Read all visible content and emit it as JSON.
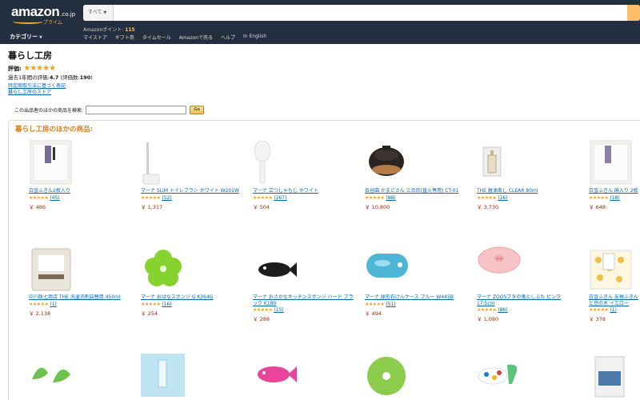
{
  "header": {
    "logo_word": "amazon",
    "logo_domain": ".co.jp",
    "logo_prime": "プライム",
    "search_category": "すべて",
    "points_label": "Amazonポイント: ",
    "points_value": "115",
    "nav_links": [
      "マイストア",
      "ギフト券",
      "タイムセール",
      "Amazonで売る",
      "ヘルプ",
      "In English"
    ],
    "category_label": "カテゴリー"
  },
  "seller": {
    "name": "暮らし工房",
    "rating_label": "評価:",
    "rating_stars": "★★★★★",
    "rating_period": "過去1年間の評価:",
    "rating_value": "4.7",
    "rating_count_label": "(評価数:",
    "rating_count": "190",
    "rating_count_close": ")",
    "links": [
      "特定商取引法に基づく表記",
      "暮らし工房のストア"
    ]
  },
  "seller_search": {
    "label": "この出品者のほかの商品を検索:",
    "button": "Go"
  },
  "products_panel": {
    "title": "暮らし工房のほかの商品:"
  },
  "products": [
    {
      "title": "白雪ふきん2枚入り",
      "stars": "★★★★★",
      "reviews": "(45)",
      "price": "￥ 486"
    },
    {
      "title": "マーナ SLIM トイレブラシ ホワイト W201W",
      "stars": "★★★★★",
      "reviews": "(52)",
      "price": "￥ 1,317"
    },
    {
      "title": "マーナ 立つしゃもじ ホワイト",
      "stars": "★★★★★",
      "reviews": "(267)",
      "price": "￥ 504"
    },
    {
      "title": "長谷園 かまどさん 三合炊(直火専用) CT-01",
      "stars": "★★★★★",
      "reviews": "(88)",
      "price": "￥ 10,800"
    },
    {
      "title": "THE 醤油差し CLEAR 80ml",
      "stars": "★★★★★",
      "reviews": "(26)",
      "price": "￥ 3,730"
    },
    {
      "title": "白雪ふきん 麻入り 2枚",
      "stars": "★★★★★",
      "reviews": "(18)",
      "price": "￥ 648"
    },
    {
      "title": "中川政七商店 THE 洗濯洗剤詰替用 450ml",
      "stars": "★★★★★",
      "reviews": "(1)",
      "price": "￥ 2,138"
    },
    {
      "title": "マーナ おはなスポンジ G K364G",
      "stars": "★★★★★",
      "reviews": "(16)",
      "price": "￥ 254"
    },
    {
      "title": "マーナ おさかなキッチンスポンジ ハード ブラック K180",
      "stars": "★★★★★",
      "reviews": "(15)",
      "price": "￥ 288"
    },
    {
      "title": "マーナ 球形石けんケース ブルー W445B",
      "stars": "★★★★★",
      "reviews": "(51)",
      "price": "￥ 494"
    },
    {
      "title": "マーナ ZOOSブタの落としぶた ピンク 17.5cm",
      "stars": "★★★★★",
      "reviews": "(86)",
      "price": "￥ 1,080"
    },
    {
      "title": "白雪ふきん 友禅ふきん と豆の木 イエロー",
      "stars": "★★★★★",
      "reviews": "(1)",
      "price": "￥ 378"
    }
  ],
  "colors": {
    "nav_bg": "#232f3e",
    "link": "#0066c0",
    "price": "#b12704",
    "star": "#f0a11c",
    "panel_title": "#e47911",
    "search_button": "#febd69"
  }
}
